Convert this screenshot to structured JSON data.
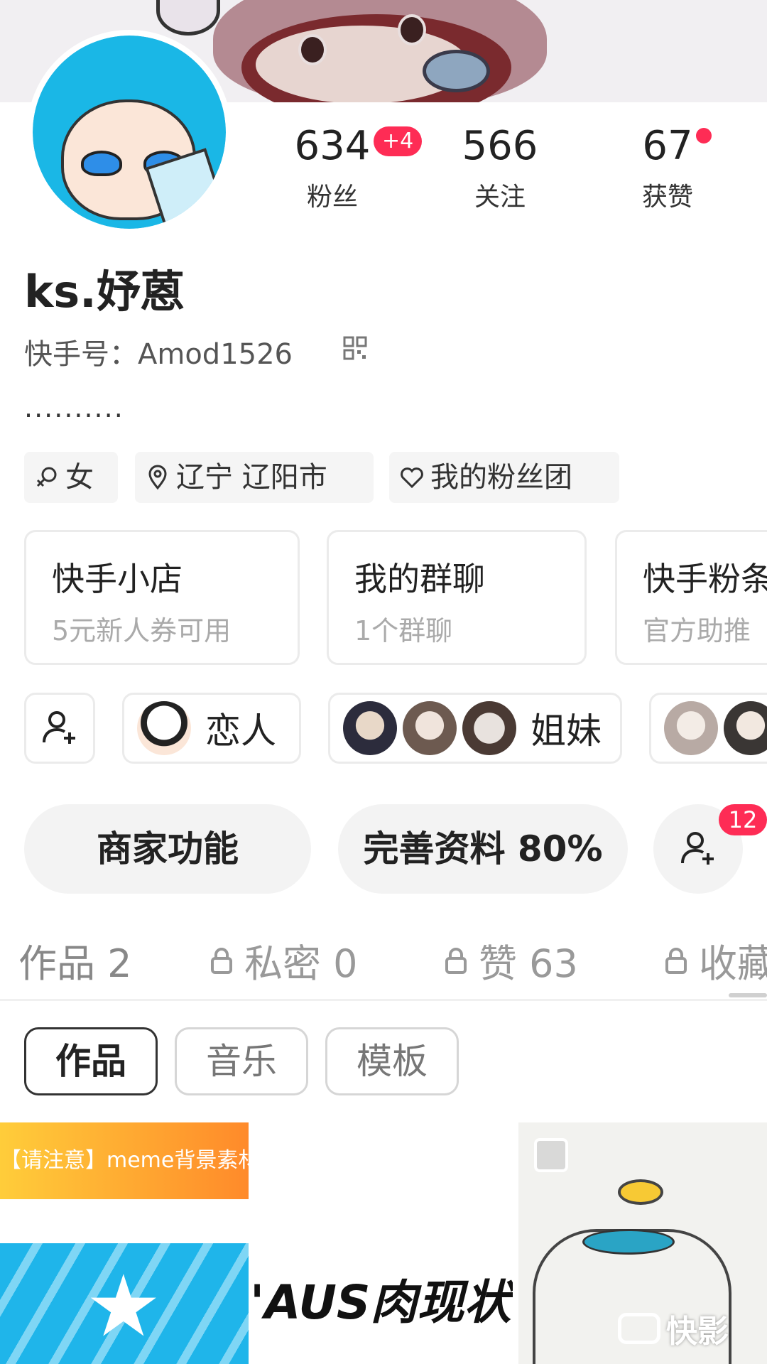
{
  "profile": {
    "name": "ks.妤蒽",
    "id_label": "快手号：",
    "id_value": "Amod1526",
    "bio": "..........",
    "stats": [
      {
        "value": "634",
        "label": "粉丝",
        "badge": "+4"
      },
      {
        "value": "566",
        "label": "关注"
      },
      {
        "value": "67",
        "label": "获赞"
      }
    ],
    "tags": [
      "女",
      "辽宁 辽阳市",
      "我的粉丝团"
    ]
  },
  "cards": [
    {
      "title": "快手小店",
      "subtitle": "5元新人券可用"
    },
    {
      "title": "我的群聊",
      "subtitle": "1个群聊"
    },
    {
      "title": "快手粉条",
      "subtitle": "官方助推"
    }
  ],
  "relations": [
    {
      "label": "恋人"
    },
    {
      "label": "姐妹"
    }
  ],
  "actions": {
    "merchant": "商家功能",
    "complete": "完善资料 80%",
    "friend_badge": "12"
  },
  "tabs": [
    "作品 2",
    "私密 0",
    "赞 63",
    "收藏"
  ],
  "subtabs": [
    "作品",
    "音乐",
    "模板"
  ],
  "content": {
    "thumb1_banner": "【请注意】meme背景素材",
    "thumb1_text": "'AUS肉现状"
  },
  "watermark": "快影",
  "colors": {
    "accent": "#fe2c55"
  }
}
